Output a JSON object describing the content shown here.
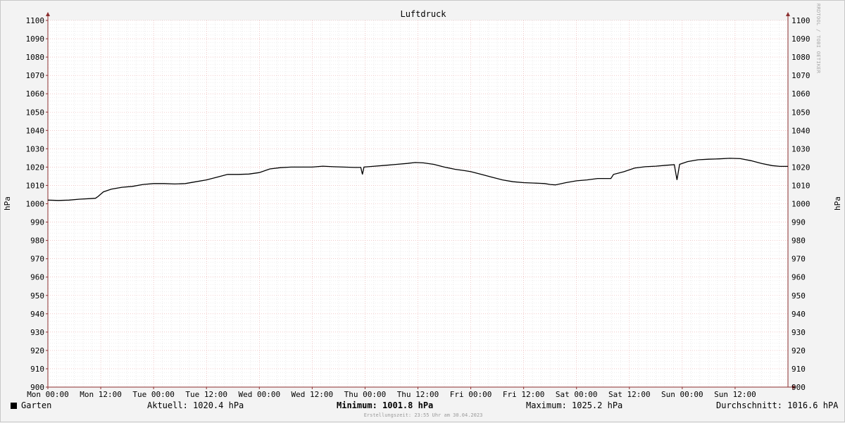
{
  "chart_data": {
    "type": "line",
    "title": "Luftdruck",
    "ylabel": "hPa",
    "ylim": [
      900,
      1100
    ],
    "ytick_step": 10,
    "xlim": [
      0,
      14
    ],
    "x_ticks": [
      {
        "x": 0,
        "label": "Mon 00:00"
      },
      {
        "x": 1,
        "label": "Mon 12:00"
      },
      {
        "x": 2,
        "label": "Tue 00:00"
      },
      {
        "x": 3,
        "label": "Tue 12:00"
      },
      {
        "x": 4,
        "label": "Wed 00:00"
      },
      {
        "x": 5,
        "label": "Wed 12:00"
      },
      {
        "x": 6,
        "label": "Thu 00:00"
      },
      {
        "x": 7,
        "label": "Thu 12:00"
      },
      {
        "x": 8,
        "label": "Fri 00:00"
      },
      {
        "x": 9,
        "label": "Fri 12:00"
      },
      {
        "x": 10,
        "label": "Sat 00:00"
      },
      {
        "x": 11,
        "label": "Sat 12:00"
      },
      {
        "x": 12,
        "label": "Sun 00:00"
      },
      {
        "x": 13,
        "label": "Sun 12:00"
      }
    ],
    "series": [
      {
        "name": "Garten",
        "color": "#000000",
        "points": [
          [
            0,
            1002
          ],
          [
            0.2,
            1001.8
          ],
          [
            0.4,
            1002
          ],
          [
            0.6,
            1002.5
          ],
          [
            0.8,
            1002.8
          ],
          [
            0.9,
            1003
          ],
          [
            0.95,
            1004
          ],
          [
            1.05,
            1006.5
          ],
          [
            1.2,
            1008
          ],
          [
            1.4,
            1009
          ],
          [
            1.6,
            1009.5
          ],
          [
            1.8,
            1010.5
          ],
          [
            2.0,
            1011
          ],
          [
            2.2,
            1011
          ],
          [
            2.4,
            1010.8
          ],
          [
            2.6,
            1011
          ],
          [
            2.8,
            1012
          ],
          [
            3.0,
            1013
          ],
          [
            3.2,
            1014.5
          ],
          [
            3.4,
            1016
          ],
          [
            3.6,
            1016
          ],
          [
            3.8,
            1016.2
          ],
          [
            4.0,
            1017
          ],
          [
            4.2,
            1019
          ],
          [
            4.4,
            1019.7
          ],
          [
            4.6,
            1020
          ],
          [
            4.8,
            1020
          ],
          [
            5.0,
            1020
          ],
          [
            5.2,
            1020.5
          ],
          [
            5.4,
            1020.2
          ],
          [
            5.6,
            1020
          ],
          [
            5.8,
            1019.8
          ],
          [
            5.92,
            1019.8
          ],
          [
            5.95,
            1016
          ],
          [
            5.98,
            1020
          ],
          [
            6.1,
            1020.3
          ],
          [
            6.4,
            1021
          ],
          [
            6.6,
            1021.5
          ],
          [
            6.8,
            1022
          ],
          [
            6.95,
            1022.5
          ],
          [
            7.1,
            1022.3
          ],
          [
            7.3,
            1021.5
          ],
          [
            7.5,
            1020
          ],
          [
            7.7,
            1018.8
          ],
          [
            7.9,
            1018
          ],
          [
            8.0,
            1017.5
          ],
          [
            8.2,
            1016
          ],
          [
            8.4,
            1014.5
          ],
          [
            8.6,
            1013
          ],
          [
            8.8,
            1012
          ],
          [
            9.0,
            1011.5
          ],
          [
            9.2,
            1011.3
          ],
          [
            9.4,
            1011
          ],
          [
            9.5,
            1010.5
          ],
          [
            9.6,
            1010.3
          ],
          [
            9.8,
            1011.5
          ],
          [
            10.0,
            1012.5
          ],
          [
            10.2,
            1013
          ],
          [
            10.4,
            1013.8
          ],
          [
            10.6,
            1013.8
          ],
          [
            10.65,
            1013.8
          ],
          [
            10.7,
            1016
          ],
          [
            10.9,
            1017.5
          ],
          [
            11.1,
            1019.5
          ],
          [
            11.3,
            1020.2
          ],
          [
            11.5,
            1020.5
          ],
          [
            11.7,
            1021
          ],
          [
            11.85,
            1021.3
          ],
          [
            11.9,
            1013
          ],
          [
            11.95,
            1021.5
          ],
          [
            12.1,
            1023
          ],
          [
            12.3,
            1024
          ],
          [
            12.5,
            1024.3
          ],
          [
            12.7,
            1024.5
          ],
          [
            12.9,
            1024.8
          ],
          [
            13.1,
            1024.6
          ],
          [
            13.3,
            1023.5
          ],
          [
            13.5,
            1022
          ],
          [
            13.7,
            1020.8
          ],
          [
            13.85,
            1020.4
          ],
          [
            14.0,
            1020.4
          ]
        ]
      }
    ],
    "grid": true,
    "legend": "bottom-left"
  },
  "legend": {
    "series_name": "Garten",
    "current": "Aktuell: 1020.4 hPa",
    "minimum_label": "Minimum:",
    "minimum_value": "1001.8 hPa",
    "maximum": "Maximum: 1025.2 hPa",
    "average": "Durchschnitt: 1016.6 hPA"
  },
  "footer": "Erstellungszeit: 23:55 Uhr am 30.04.2023",
  "watermark": "RRDTOOL / TOBI OETIKER",
  "colors": {
    "plot_bg": "#ffffff",
    "minor_grid": "#dcdcdc",
    "major_grid": "#e8a8a8",
    "axis": "#8b2e2e",
    "line": "#000000"
  }
}
